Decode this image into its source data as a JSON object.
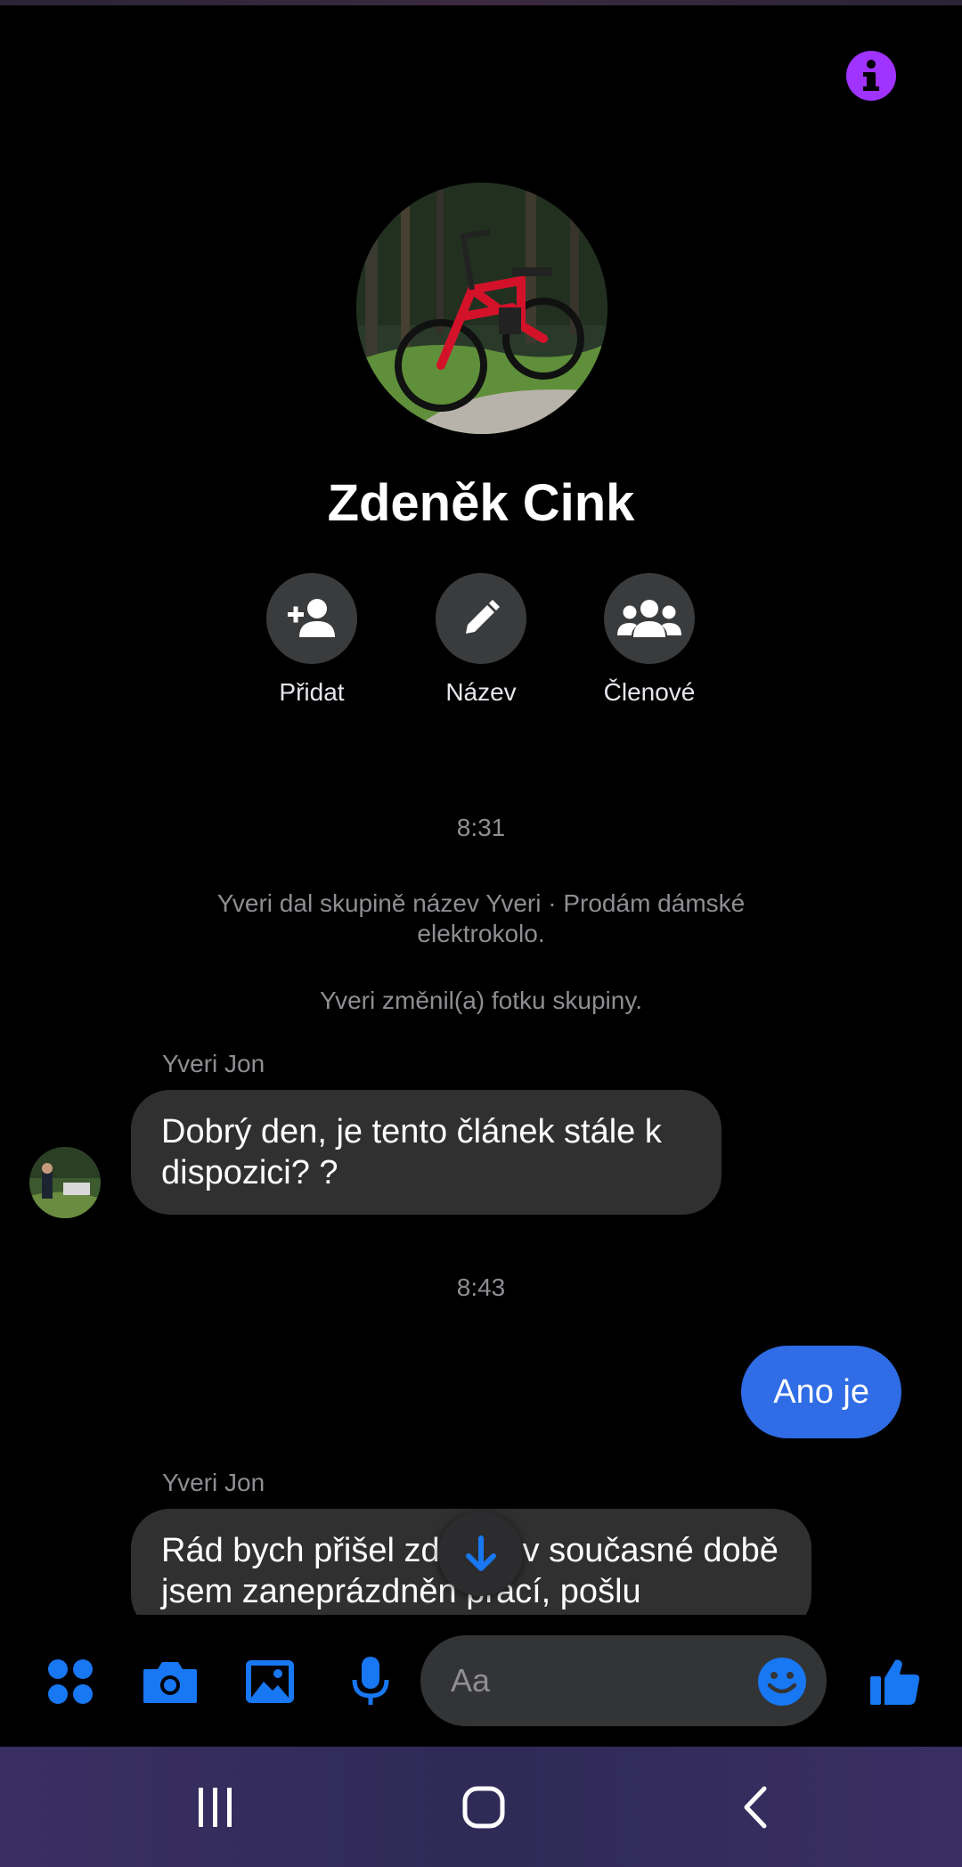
{
  "header": {
    "title": "Zdeněk Cink",
    "info_icon": "info-icon"
  },
  "actions": [
    {
      "label": "Přidat",
      "icon": "add-person-icon"
    },
    {
      "label": "Název",
      "icon": "pencil-icon"
    },
    {
      "label": "Členové",
      "icon": "group-icon"
    }
  ],
  "conversation": {
    "time1": "8:31",
    "system1": "Yveri dal skupině název Yveri · Prodám dámské elektrokolo.",
    "system2": "Yveri změnil(a) fotku skupiny.",
    "sender1": "Yveri Jon",
    "msg1": "Dobrý den, je tento článek stále k dispozici? ?",
    "time2": "8:43",
    "msg_out": "Ano je",
    "sender2": "Yveri Jon",
    "msg2": "Rád bych přišel zde ale v současné době jsem zaneprázdněn prací, pošlu"
  },
  "composer": {
    "placeholder": "Aa",
    "tools": [
      "apps-icon",
      "camera-icon",
      "gallery-icon",
      "microphone-icon",
      "emoji-icon",
      "thumbs-up-icon"
    ]
  },
  "colors": {
    "accent": "#1877f2",
    "outgoing_bubble": "#2f6ce5",
    "incoming_bubble": "#303030",
    "info": "#a033ff"
  }
}
